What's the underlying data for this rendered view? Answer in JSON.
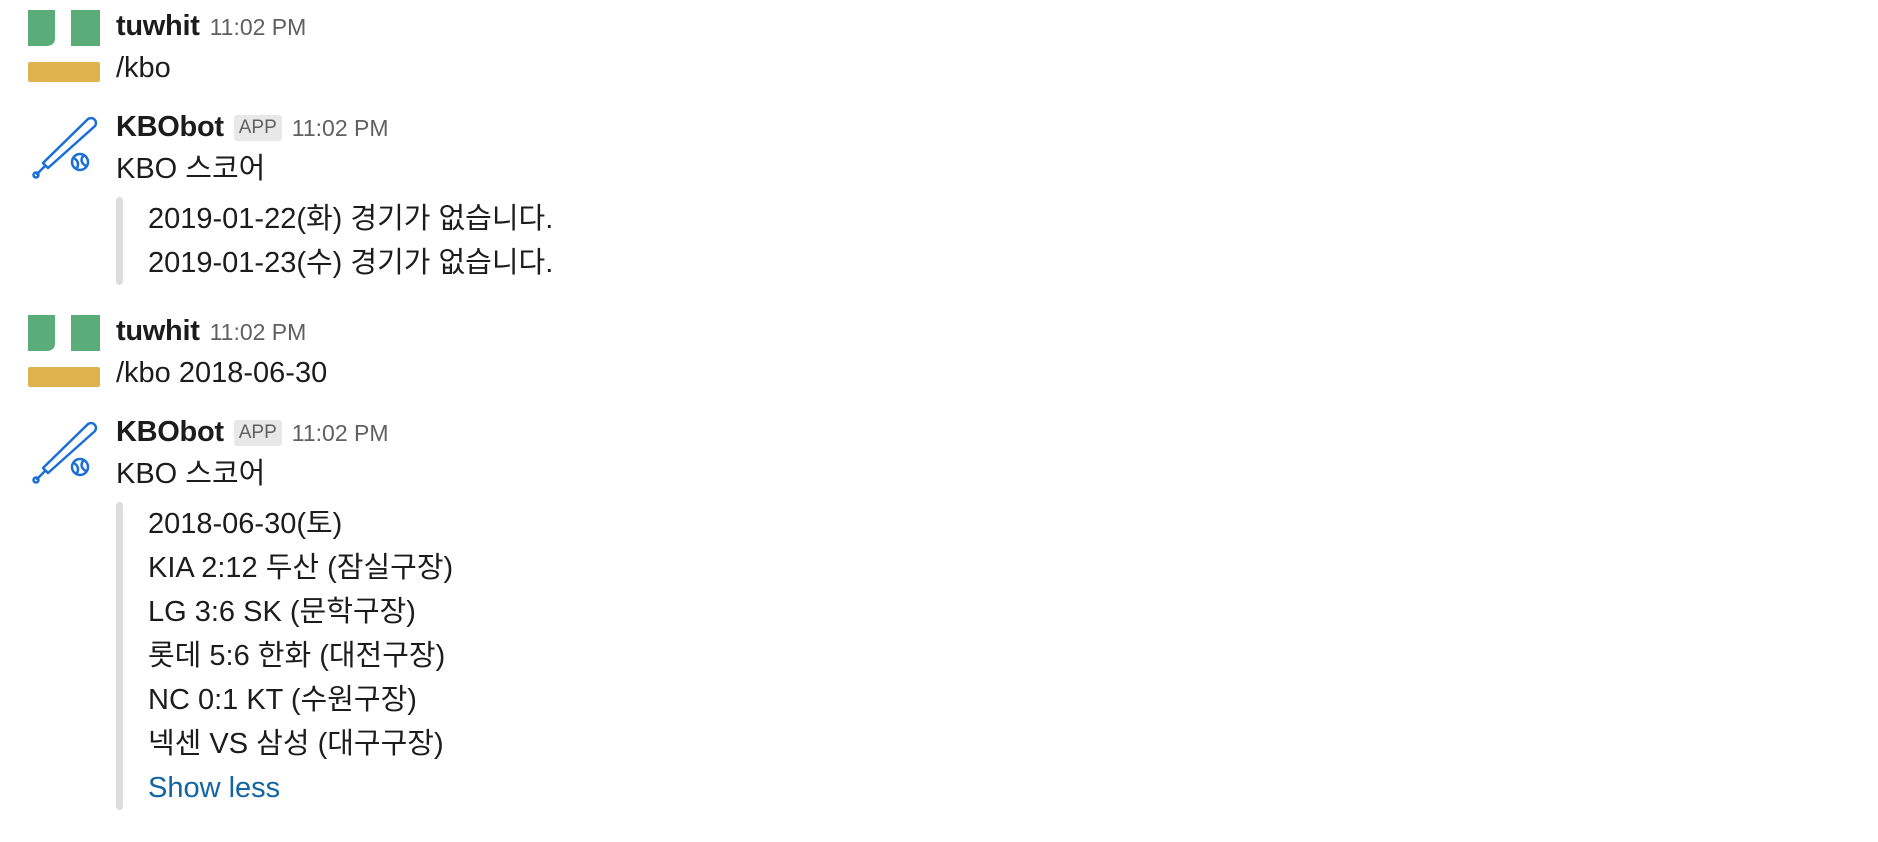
{
  "messages": [
    {
      "sender": "tuwhit",
      "time": "11:02 PM",
      "text": "/kbo"
    },
    {
      "sender": "KBObot",
      "badge": "APP",
      "time": "11:02 PM",
      "text": "KBO 스코어",
      "attachment_lines": [
        "2019-01-22(화) 경기가 없습니다.",
        "2019-01-23(수) 경기가 없습니다."
      ]
    },
    {
      "sender": "tuwhit",
      "time": "11:02 PM",
      "text": "/kbo 2018-06-30"
    },
    {
      "sender": "KBObot",
      "badge": "APP",
      "time": "11:02 PM",
      "text": "KBO 스코어",
      "attachment_lines": [
        "2018-06-30(토)",
        "KIA 2:12 두산 (잠실구장)",
        "LG 3:6 SK (문학구장)",
        "롯데 5:6 한화 (대전구장)",
        "NC 0:1 KT (수원구장)",
        "넥센 VS 삼성 (대구구장)"
      ],
      "toggle_label": "Show less"
    }
  ],
  "colors": {
    "user_avatar_green": "#5aad78",
    "user_avatar_yellow": "#e0b24d",
    "bot_icon_blue": "#1a6fd6",
    "link_blue": "#1264a3",
    "attachment_bar": "#dddddd"
  },
  "icons": {
    "user_avatar": "identicon-avatar",
    "bot_avatar": "baseball-bat-icon"
  }
}
